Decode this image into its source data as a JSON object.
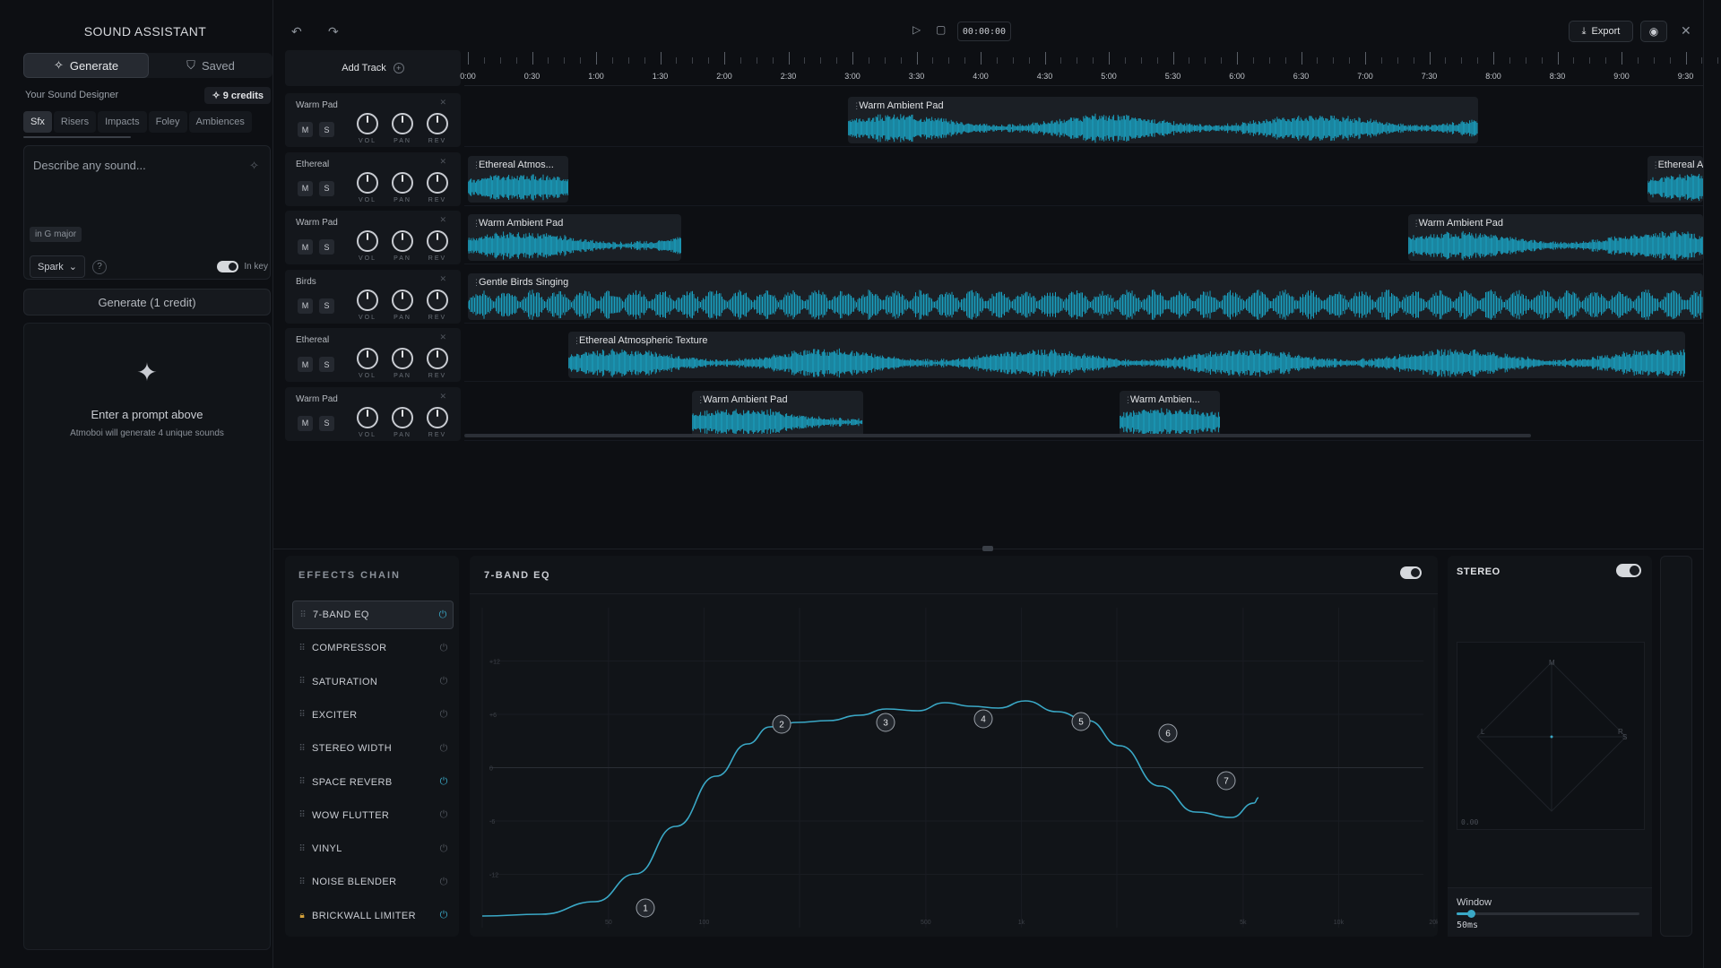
{
  "sidebar": {
    "title": "SOUND ASSISTANT",
    "tabs": [
      {
        "label": "Generate"
      },
      {
        "label": "Saved"
      }
    ],
    "designer_label": "Your Sound Designer",
    "credits": "9 credits",
    "categories": [
      "Sfx",
      "Risers",
      "Impacts",
      "Foley",
      "Ambiences"
    ],
    "prompt_placeholder": "Describe any sound...",
    "key_chip": "in G major",
    "model": "Spark",
    "help": "?",
    "inkey_label": "In key",
    "generate_button": "Generate (1 credit)",
    "empty_title": "Enter a prompt above",
    "empty_sub": "Atmoboi will generate 4 unique sounds"
  },
  "topbar": {
    "timecode": "00:00:00",
    "export_label": "Export"
  },
  "timeline": {
    "add_track_label": "Add Track",
    "ruler": [
      "0:00",
      "0:30",
      "1:00",
      "1:30",
      "2:00",
      "2:30",
      "3:00",
      "3:30",
      "4:00",
      "4:30",
      "5:00",
      "5:30",
      "6:00",
      "6:30",
      "7:00",
      "7:30",
      "8:00",
      "8:30",
      "9:00",
      "9:30"
    ],
    "knob_labels": [
      "VOL",
      "PAN",
      "REV"
    ],
    "mute": "M",
    "solo": "S",
    "tracks": [
      {
        "name": "Warm Pad",
        "clips": [
          {
            "label": "Warm Ambient Pad",
            "start": "2:58",
            "end": "7:53"
          }
        ]
      },
      {
        "name": "Ethereal",
        "clips": [
          {
            "label": "Ethereal Atmos...",
            "start": "0:00",
            "end": "0:47"
          },
          {
            "label": "Ethereal At",
            "start": "9:12",
            "end": "9:45"
          }
        ]
      },
      {
        "name": "Warm Pad",
        "clips": [
          {
            "label": "Warm Ambient Pad",
            "start": "0:00",
            "end": "1:40"
          },
          {
            "label": "Warm Ambient Pad",
            "start": "7:20",
            "end": "9:45"
          }
        ]
      },
      {
        "name": "Birds",
        "clips": [
          {
            "label": "Gentle Birds Singing",
            "start": "0:00",
            "end": "9:45"
          }
        ]
      },
      {
        "name": "Ethereal",
        "clips": [
          {
            "label": "Ethereal Atmospheric Texture",
            "start": "0:47",
            "end": "9:30"
          }
        ]
      },
      {
        "name": "Warm Pad",
        "clips": [
          {
            "label": "Warm Ambient Pad",
            "start": "1:45",
            "end": "3:05"
          },
          {
            "label": "Warm Ambien...",
            "start": "5:05",
            "end": "5:52"
          }
        ]
      }
    ]
  },
  "effects_chain": {
    "title": "EFFECTS CHAIN",
    "items": [
      {
        "name": "7-BAND EQ",
        "active": true,
        "on": true
      },
      {
        "name": "COMPRESSOR",
        "active": false,
        "on": false
      },
      {
        "name": "SATURATION",
        "active": false,
        "on": false
      },
      {
        "name": "EXCITER",
        "active": false,
        "on": false
      },
      {
        "name": "STEREO WIDTH",
        "active": false,
        "on": false
      },
      {
        "name": "SPACE REVERB",
        "active": false,
        "on": true
      },
      {
        "name": "WOW FLUTTER",
        "active": false,
        "on": false
      },
      {
        "name": "VINYL",
        "active": false,
        "on": false
      },
      {
        "name": "NOISE BLENDER",
        "active": false,
        "on": false
      },
      {
        "name": "BRICKWALL LIMITER",
        "active": false,
        "on": true,
        "locked": true
      }
    ]
  },
  "eq": {
    "title": "7-BAND EQ",
    "db_labels": [
      "+12",
      "+6",
      "0",
      "-6",
      "-12"
    ],
    "freq_labels": [
      "50",
      "100",
      "500",
      "1k",
      "5k",
      "10k",
      "20k"
    ],
    "bands": [
      "1",
      "2",
      "3",
      "4",
      "5",
      "6",
      "7"
    ]
  },
  "stereo": {
    "title": "STEREO",
    "scope_labels": {
      "m": "M",
      "l": "L",
      "r": "R",
      "s": "S"
    },
    "readout": "0.00",
    "window_label": "Window",
    "window_value": "50ms",
    "window_fraction": 0.08
  },
  "colors": {
    "accent": "#3aa8c6",
    "waveform": "#1a9fbf",
    "background": "#0d0f13"
  }
}
